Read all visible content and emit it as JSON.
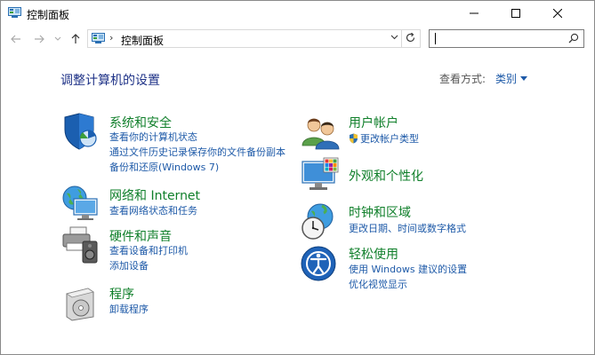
{
  "window": {
    "title": "控制面板"
  },
  "address": {
    "path": "控制面板",
    "separator": "›"
  },
  "search": {
    "value": "",
    "placeholder": ""
  },
  "page": {
    "title": "调整计算机的设置",
    "view_by_label": "查看方式:",
    "view_by_value": "类别"
  },
  "categories": {
    "security": {
      "title": "系统和安全",
      "links": [
        "查看你的计算机状态",
        "通过文件历史记录保存你的文件备份副本",
        "备份和还原(Windows 7)"
      ]
    },
    "network": {
      "title": "网络和 Internet",
      "links": [
        "查看网络状态和任务"
      ]
    },
    "hardware": {
      "title": "硬件和声音",
      "links": [
        "查看设备和打印机",
        "添加设备"
      ]
    },
    "programs": {
      "title": "程序",
      "links": [
        "卸载程序"
      ]
    },
    "users": {
      "title": "用户帐户",
      "links": [
        "更改帐户类型"
      ]
    },
    "appearance": {
      "title": "外观和个性化",
      "links": []
    },
    "clock": {
      "title": "时钟和区域",
      "links": [
        "更改日期、时间或数字格式"
      ]
    },
    "ease": {
      "title": "轻松使用",
      "links": [
        "使用 Windows 建议的设置",
        "优化视觉显示"
      ]
    }
  },
  "icons": {
    "title": "control-panel-icon",
    "back": "arrow-left-icon",
    "forward": "arrow-right-icon",
    "recent": "chevron-down-icon",
    "up": "arrow-up-icon",
    "refresh": "refresh-icon",
    "search": "search-icon"
  },
  "colors": {
    "category_title": "#0f7f2a",
    "link": "#1e5aa8",
    "page_title": "#1e3287"
  }
}
